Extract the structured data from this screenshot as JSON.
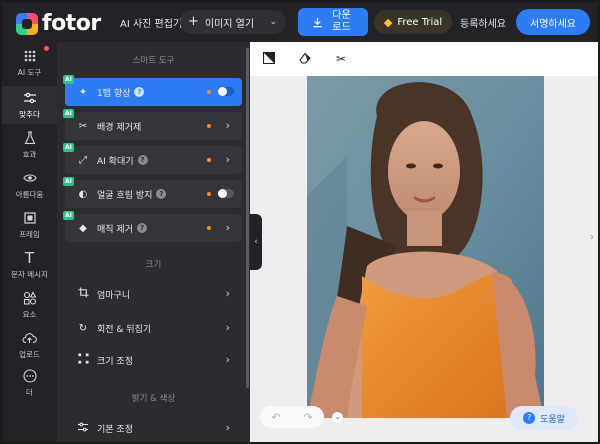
{
  "header": {
    "logo_text": "fotor",
    "app_title": "AI 사진 편집기",
    "open_image": {
      "label": "이미지 열기"
    },
    "download_label": "다운로드",
    "trial_label": "Free Trial",
    "signup_label": "등록하세요",
    "login_label": "서명하세요"
  },
  "rail": {
    "items": [
      {
        "label": "AI 도구",
        "icon": "apps-grid-icon"
      },
      {
        "label": "맞추다",
        "icon": "sliders-icon"
      },
      {
        "label": "효과",
        "icon": "flask-icon"
      },
      {
        "label": "아름다움",
        "icon": "eye-icon"
      },
      {
        "label": "프레임",
        "icon": "frame-icon"
      },
      {
        "label": "문자 메시지",
        "icon": "text-icon"
      },
      {
        "label": "요소",
        "icon": "shapes-icon"
      },
      {
        "label": "업로드",
        "icon": "cloud-upload-icon"
      },
      {
        "label": "더",
        "icon": "more-icon"
      }
    ]
  },
  "panel": {
    "smart_section": "스마트 도구",
    "smart_tools": [
      {
        "label": "1탭 향상",
        "badge": "AI",
        "help": "?",
        "control": "toggle"
      },
      {
        "label": "배경 제거제",
        "badge": "AI",
        "help": "",
        "control": "chevron"
      },
      {
        "label": "AI 확대기",
        "badge": "AI",
        "help": "?",
        "control": "chevron"
      },
      {
        "label": "얼굴 흐림 방지",
        "badge": "AI",
        "help": "?",
        "control": "toggle"
      },
      {
        "label": "매직 제거",
        "badge": "AI",
        "help": "?",
        "control": "chevron"
      }
    ],
    "size_section": "크기",
    "size_tools": [
      {
        "label": "엄마구니",
        "icon": "crop-icon"
      },
      {
        "label": "회전 & 뒤집기",
        "icon": "rotate-icon"
      },
      {
        "label": "크기 조정",
        "icon": "resize-icon"
      }
    ],
    "color_section": "밝기 & 색상",
    "color_tools": [
      {
        "label": "기본 조정",
        "icon": "adjust-icon"
      }
    ]
  },
  "canvas": {
    "toolbar_icons": [
      "compare-icon",
      "eraser-icon",
      "scissors-icon"
    ],
    "help_label": "도움말",
    "help_icon": "?"
  },
  "colors": {
    "accent": "#2d7cf6",
    "ai_badge": "#24c78a",
    "panel_bg": "#2b2b30",
    "dark_bg": "#232327",
    "orange_dot": "#ff8a2b"
  }
}
